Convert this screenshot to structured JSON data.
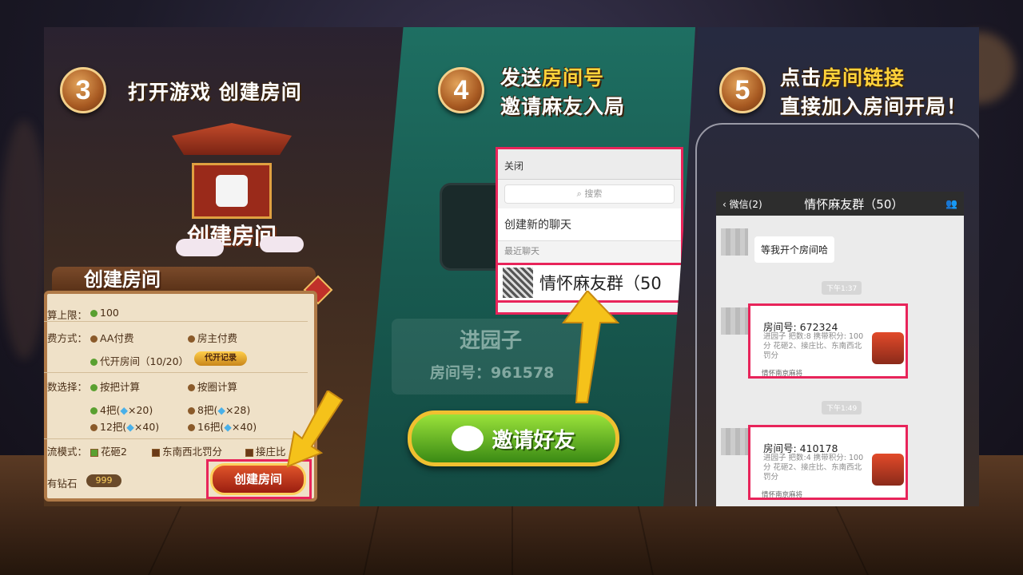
{
  "step3": {
    "number": "3",
    "title": "打开游戏 创建房间",
    "pavilion_title": "创建房间",
    "form_title": "创建房间",
    "rows": {
      "limit_label": "算上限：",
      "limit_value": "100",
      "pay_label": "费方式：",
      "pay_aa": "AA付费",
      "pay_host": "房主付费",
      "pay_proxy": "代开房间（",
      "pay_proxy_count": "10/20）",
      "record_button": "代开记录",
      "count_label": "数选择：",
      "by_round": "按把计算",
      "by_circle": "按圈计算",
      "opt1": "4把(",
      "opt1_cost": "×20)",
      "opt2": "8把(",
      "opt2_cost": "×28)",
      "opt3": "12把(",
      "opt3_cost": "×40)",
      "opt4": "16把(",
      "opt4_cost": "×40)",
      "mode_label": "流模式：",
      "mode1": "花砸2",
      "mode2": "东南西北罚分",
      "mode3": "接庄比",
      "diamond_label": "有钻石",
      "diamond_value": "999",
      "create_button": "创建房间"
    }
  },
  "step4": {
    "number": "4",
    "title_prefix": "发送",
    "title_highlight": "房间号",
    "title_line2": "邀请麻友入局",
    "room_name": "进园子",
    "room_no": "房间号：961578",
    "wechat": {
      "close": "关闭",
      "search": "搜索",
      "new_chat": "创建新的聊天",
      "recent": "最近聊天",
      "group": "情怀麻友群（50"
    },
    "invite_button": "邀请好友"
  },
  "step5": {
    "number": "5",
    "title_prefix": "点击",
    "title_highlight": "房间链接",
    "title_line2": "直接加入房间开局！",
    "chat": {
      "back": "微信(2)",
      "title": "情怀麻友群（50）",
      "msg1": "等我开个房间哈",
      "time1": "下午1:37",
      "card1_title": "房间号: 672324",
      "card1_desc": "进园子 把数:8 携带积分: 100分 花砸2、接庄比、东南西北罚分",
      "card1_foot": "情怀南京麻将",
      "time2": "下午1:49",
      "card2_title": "房间号: 410178",
      "card2_desc": "进园子 把数:4 携带积分: 100分 花砸2、接庄比、东南西北罚分",
      "card2_foot": "情怀南京麻将"
    }
  }
}
